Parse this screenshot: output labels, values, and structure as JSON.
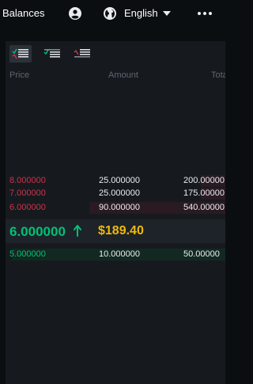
{
  "nav": {
    "balances_label": "Balances",
    "language_label": "English",
    "icons": [
      "user-icon",
      "globe-icon",
      "caret-down-icon",
      "more-icon"
    ]
  },
  "orderbook": {
    "view_modes": [
      "both",
      "bids",
      "asks"
    ],
    "active_view": "both",
    "columns": {
      "price": "Price",
      "amount": "Amount",
      "total": "Tota"
    },
    "asks": [
      {
        "price": "8.000000",
        "amount": "25.000000",
        "total": "200.00000"
      },
      {
        "price": "7.000000",
        "amount": "25.000000",
        "total": "175.00000"
      },
      {
        "price": "6.000000",
        "amount": "90.000000",
        "total": "540.00000"
      }
    ],
    "ask_depth_fractions": [
      0.11,
      0.11,
      0.62
    ],
    "bids": [
      {
        "price": "5.000000",
        "amount": "10.000000",
        "total": "50.00000"
      }
    ],
    "bid_depth_fractions": [
      0.97
    ],
    "last_price": "6.000000",
    "last_price_direction": "up",
    "fiat_price": "$189.40"
  },
  "colors": {
    "ask": "#cf304a",
    "bid": "#02c076",
    "fiat": "#f0b90b",
    "background": "#0b0e11",
    "panel": "#161a1e"
  }
}
